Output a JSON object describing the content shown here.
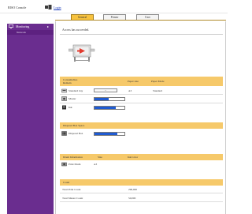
{
  "header": {
    "app_title": "RISO Console",
    "login_label": "Login"
  },
  "sidebar": {
    "monitoring_label": "Monitoring",
    "monitoring_arrow": "▸",
    "network_label": "Network"
  },
  "tabs": [
    {
      "label": "General",
      "active": true
    },
    {
      "label": "Printer",
      "active": false
    },
    {
      "label": "User",
      "active": false
    }
  ],
  "main": {
    "heading": "Access has succeeded."
  },
  "consumables": {
    "header_label_line1": "Consumables",
    "header_label_line2": "Remain",
    "col_paper_size": "Paper size",
    "col_paper_mode": "Paper Mode",
    "rows": [
      {
        "icon": "paper-tray-icon",
        "label": "Standard tray",
        "select": "...",
        "size": "A3",
        "mode": "Standard"
      },
      {
        "icon": "master-icon",
        "label": "Master",
        "level": 0.48
      },
      {
        "icon": "ink-icon",
        "label": "Ink",
        "level": 0.72
      }
    ]
  },
  "disposal": {
    "header_label": "Disposal Box Space",
    "row_icon": "disposal-box-icon",
    "row_label": "Disposal Box",
    "level": 0.76
  },
  "drum": {
    "col_drum_info": "Drum Information",
    "col_size": "Size",
    "col_ink_color": "Ink Color",
    "row_icon": "drum-icon",
    "row_label": "Print Drum",
    "size": "A3"
  },
  "count": {
    "header_label": "Count",
    "rows": [
      {
        "label": "Total Print Count",
        "value": "290,000"
      },
      {
        "label": "Total Master Count",
        "value": "50,000"
      }
    ]
  },
  "colors": {
    "sidebar": "#6a2d8f",
    "tab_active": "#f7c23e",
    "section_header": "#f6c96a",
    "bar_fill": "#1f5bd2"
  }
}
